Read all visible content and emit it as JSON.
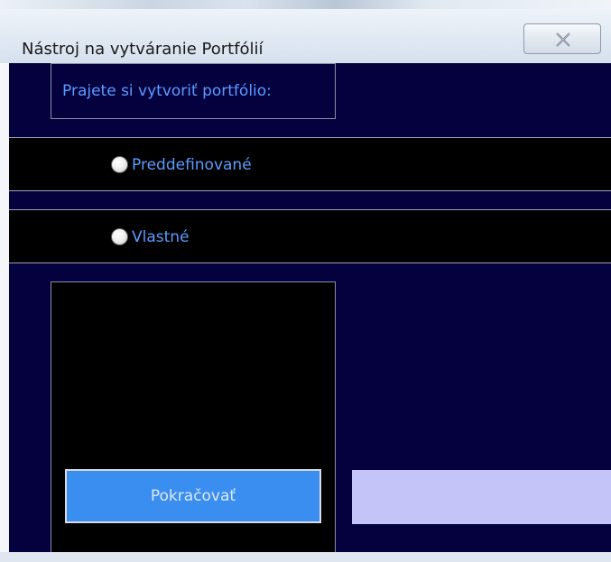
{
  "window": {
    "title": "Nástroj na vytváranie Portfólií"
  },
  "prompt": {
    "label": "Prajete si vytvoriť portfólio:"
  },
  "options": [
    {
      "label": "Preddefinované",
      "selected": false
    },
    {
      "label": "Vlastné",
      "selected": false
    }
  ],
  "buttons": {
    "continue_label": "Pokračovať"
  },
  "colors": {
    "background": "#05013f",
    "row_background": "#000000",
    "label_text": "#5a9cff",
    "continue_button": "#3a8ef0",
    "side_box": "#c4c4f8"
  },
  "icons": {
    "close": "close-icon",
    "radio": "radio-unchecked-icon"
  }
}
